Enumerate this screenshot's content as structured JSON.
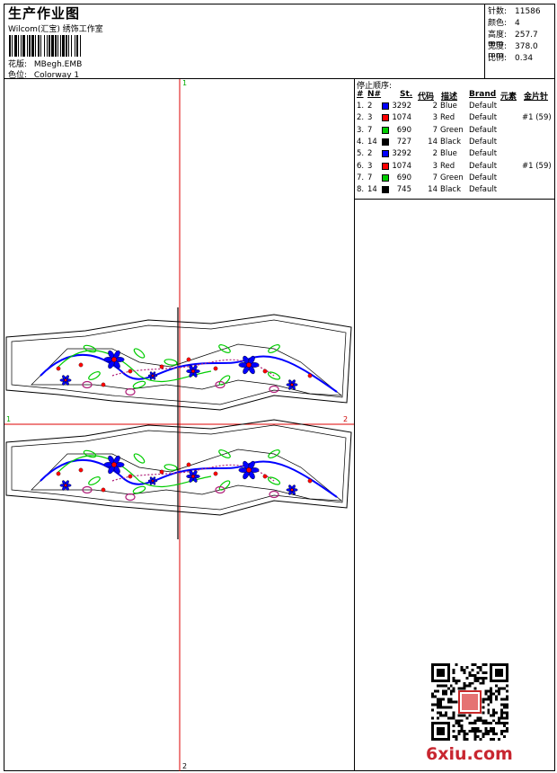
{
  "header": {
    "title": "生产作业图",
    "company": "Wilcom(汇宝) 绣饰工作室",
    "design_label": "花版:",
    "design_value": "MBegh.EMB",
    "colorway_label": "色位:",
    "colorway_value": "Colorway 1"
  },
  "stats": [
    {
      "label": "针数:",
      "value": "11586"
    },
    {
      "label": "颜色:",
      "value": "4"
    },
    {
      "label": "高度:",
      "value": "257.7 mm"
    },
    {
      "label": "宽度:",
      "value": "378.0 mm"
    },
    {
      "label": "比例:",
      "value": "0.34"
    }
  ],
  "stop_sequence": {
    "title": "停止顺序:",
    "headers": {
      "idx": "#",
      "n": "N#",
      "st": "St.",
      "code": "代码",
      "desc": "描述",
      "brand": "Brand",
      "element": "元素",
      "sequin": "金片针"
    },
    "rows": [
      {
        "idx": "1.",
        "n": "2",
        "color": "#0000ff",
        "st": "3292",
        "code": "2",
        "desc": "Blue",
        "brand": "Default",
        "sequin": ""
      },
      {
        "idx": "2.",
        "n": "3",
        "color": "#ff0000",
        "st": "1074",
        "code": "3",
        "desc": "Red",
        "brand": "Default",
        "sequin": "#1 (59)"
      },
      {
        "idx": "3.",
        "n": "7",
        "color": "#00cc00",
        "st": "690",
        "code": "7",
        "desc": "Green",
        "brand": "Default",
        "sequin": ""
      },
      {
        "idx": "4.",
        "n": "14",
        "color": "#000000",
        "st": "727",
        "code": "14",
        "desc": "Black",
        "brand": "Default",
        "sequin": ""
      },
      {
        "idx": "5.",
        "n": "2",
        "color": "#0000ff",
        "st": "3292",
        "code": "2",
        "desc": "Blue",
        "brand": "Default",
        "sequin": ""
      },
      {
        "idx": "6.",
        "n": "3",
        "color": "#ff0000",
        "st": "1074",
        "code": "3",
        "desc": "Red",
        "brand": "Default",
        "sequin": "#1 (59)"
      },
      {
        "idx": "7.",
        "n": "7",
        "color": "#00cc00",
        "st": "690",
        "code": "7",
        "desc": "Green",
        "brand": "Default",
        "sequin": ""
      },
      {
        "idx": "8.",
        "n": "14",
        "color": "#000000",
        "st": "745",
        "code": "14",
        "desc": "Black",
        "brand": "Default",
        "sequin": ""
      }
    ]
  },
  "crosshair": {
    "top": "1",
    "bottom": "2",
    "left": "1",
    "right": "2"
  },
  "watermark": {
    "text": "6xiu",
    "suffix": ".com"
  },
  "colors": {
    "blue": "#0000ff",
    "red": "#ff0000",
    "green": "#00cc00",
    "black": "#000000",
    "crosshair": "#dd0000",
    "purple": "#b0207a"
  }
}
